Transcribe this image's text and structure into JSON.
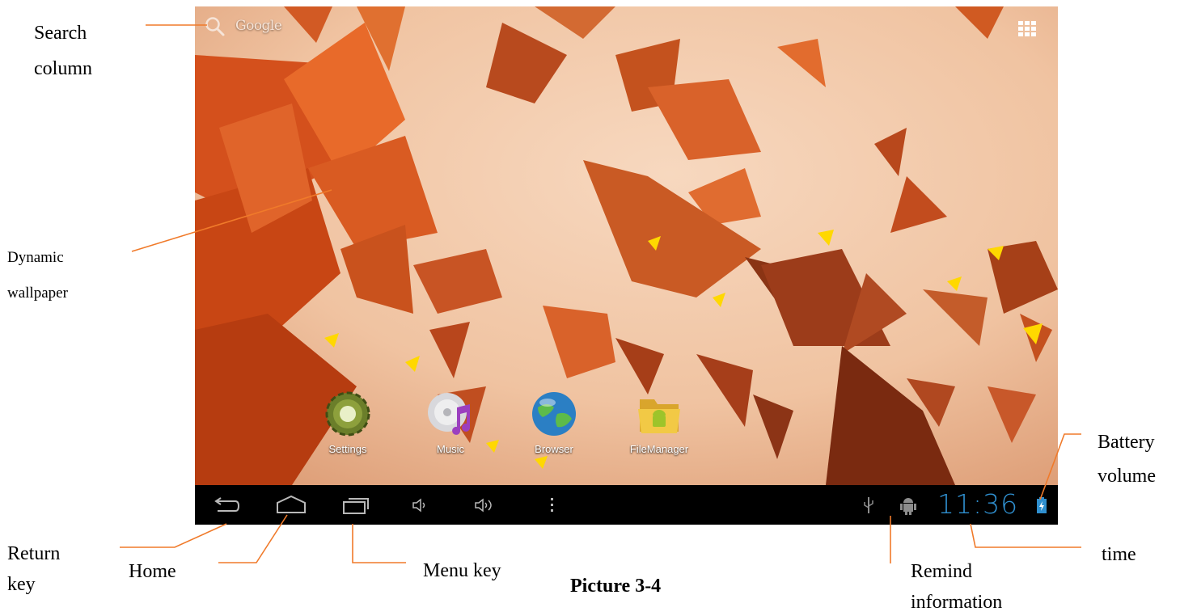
{
  "callouts": {
    "search_column_1": "Search",
    "search_column_2": "column",
    "dynamic_wallpaper_1": "Dynamic",
    "dynamic_wallpaper_2": "wallpaper",
    "return_key_1": "Return",
    "return_key_2": "key",
    "home": "Home",
    "menu_key": "Menu key",
    "remind_information_1": "Remind",
    "remind_information_2": "information",
    "time": "time",
    "battery_volume_1": "Battery",
    "battery_volume_2": "volume"
  },
  "caption": "Picture 3-4",
  "screen": {
    "search_label": "Google",
    "apps": [
      {
        "label": "Settings",
        "icon": "settings-gear-icon"
      },
      {
        "label": "Music",
        "icon": "music-disc-icon"
      },
      {
        "label": "Browser",
        "icon": "globe-icon"
      },
      {
        "label": "FileManager",
        "icon": "folder-android-icon"
      }
    ],
    "clock": "11:36",
    "navbar_icons": [
      "back-icon",
      "home-icon",
      "recent-apps-icon",
      "volume-down-icon",
      "volume-up-icon",
      "overflow-menu-icon",
      "usb-icon",
      "android-debug-icon",
      "battery-icon"
    ]
  },
  "colors": {
    "accent_orange": "#f07a2a",
    "clock_blue": "#2f8fcf",
    "navbar": "#000000"
  }
}
